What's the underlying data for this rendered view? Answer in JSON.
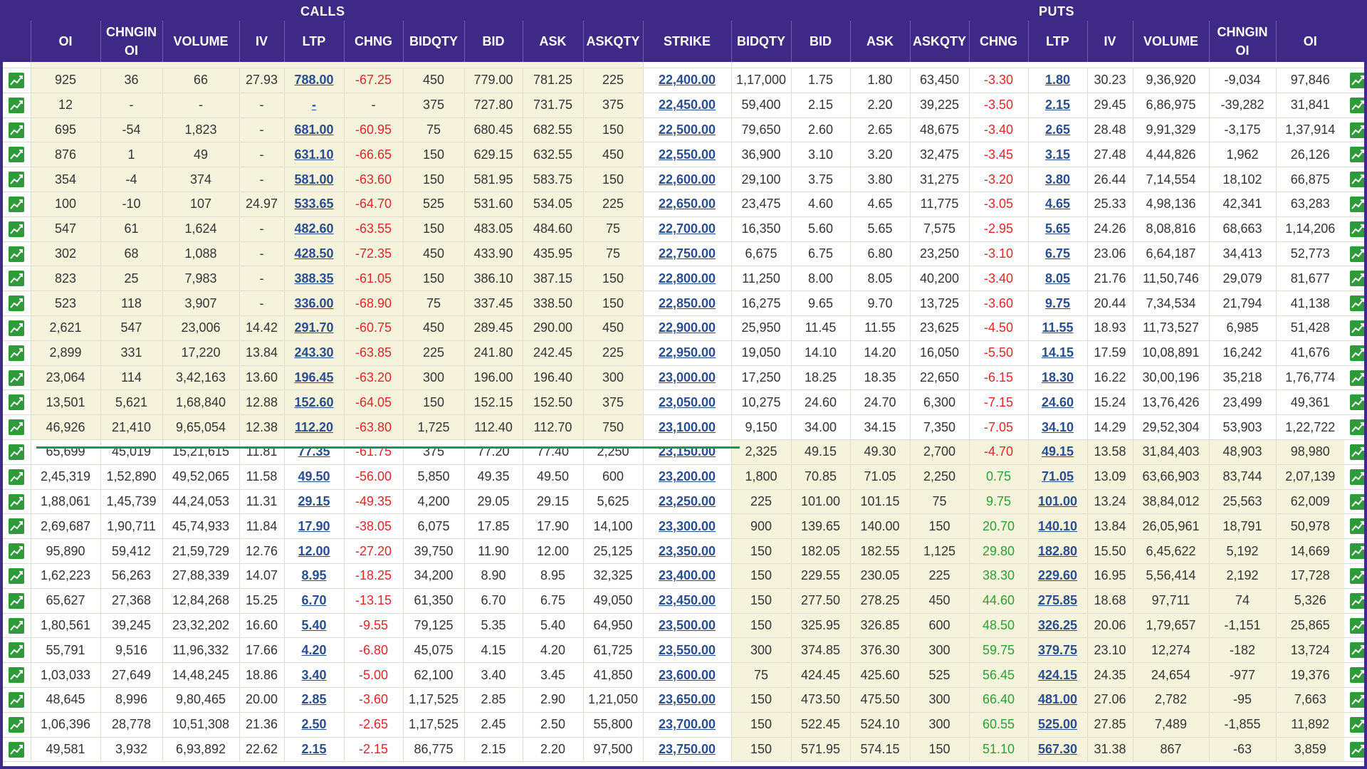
{
  "banner": {
    "calls_label": "CALLS",
    "puts_label": "PUTS"
  },
  "headers": {
    "calls": [
      "OI",
      "CHNG\nIN OI",
      "VOLUME",
      "IV",
      "LTP",
      "CHNG",
      "BID\nQTY",
      "BID",
      "ASK",
      "ASK\nQTY"
    ],
    "strike": "STRIKE",
    "puts": [
      "BID\nQTY",
      "BID",
      "ASK",
      "ASK\nQTY",
      "CHNG",
      "LTP",
      "IV",
      "VOLUME",
      "CHNG\nIN OI",
      "OI"
    ]
  },
  "colors": {
    "header_bg": "#3e2a86",
    "itm_bg": "#f6f3dc",
    "negative": "#e0262b",
    "positive": "#2e9e34",
    "link": "#2a4d8f",
    "atm_line": "#1a9a4a"
  },
  "icons": {
    "row_chart": "chart-icon"
  },
  "rows": [
    {
      "c": [
        "925",
        "36",
        "66",
        "27.93",
        "788.00",
        "-67.25",
        "450",
        "779.00",
        "781.25",
        "225"
      ],
      "s": "22,400.00",
      "p": [
        "1,17,000",
        "1.75",
        "1.80",
        "63,450",
        "-3.30",
        "1.80",
        "30.23",
        "9,36,920",
        "-9,034",
        "97,846"
      ],
      "z": "itm"
    },
    {
      "c": [
        "12",
        "-",
        "-",
        "-",
        "-",
        "-",
        "375",
        "727.80",
        "731.75",
        "375"
      ],
      "s": "22,450.00",
      "p": [
        "59,400",
        "2.15",
        "2.20",
        "39,225",
        "-3.50",
        "2.15",
        "29.45",
        "6,86,975",
        "-39,282",
        "31,841"
      ],
      "z": "itm"
    },
    {
      "c": [
        "695",
        "-54",
        "1,823",
        "-",
        "681.00",
        "-60.95",
        "75",
        "680.45",
        "682.55",
        "150"
      ],
      "s": "22,500.00",
      "p": [
        "79,650",
        "2.60",
        "2.65",
        "48,675",
        "-3.40",
        "2.65",
        "28.48",
        "9,91,329",
        "-3,175",
        "1,37,914"
      ],
      "z": "itm"
    },
    {
      "c": [
        "876",
        "1",
        "49",
        "-",
        "631.10",
        "-66.65",
        "150",
        "629.15",
        "632.55",
        "450"
      ],
      "s": "22,550.00",
      "p": [
        "36,900",
        "3.10",
        "3.20",
        "32,475",
        "-3.45",
        "3.15",
        "27.48",
        "4,44,826",
        "1,962",
        "26,126"
      ],
      "z": "itm"
    },
    {
      "c": [
        "354",
        "-4",
        "374",
        "-",
        "581.00",
        "-63.60",
        "150",
        "581.95",
        "583.75",
        "150"
      ],
      "s": "22,600.00",
      "p": [
        "29,100",
        "3.75",
        "3.80",
        "31,275",
        "-3.20",
        "3.80",
        "26.44",
        "7,14,554",
        "18,102",
        "66,875"
      ],
      "z": "itm"
    },
    {
      "c": [
        "100",
        "-10",
        "107",
        "24.97",
        "533.65",
        "-64.70",
        "525",
        "531.60",
        "534.05",
        "225"
      ],
      "s": "22,650.00",
      "p": [
        "23,475",
        "4.60",
        "4.65",
        "11,775",
        "-3.05",
        "4.65",
        "25.33",
        "4,98,136",
        "42,341",
        "63,283"
      ],
      "z": "itm"
    },
    {
      "c": [
        "547",
        "61",
        "1,624",
        "-",
        "482.60",
        "-63.55",
        "150",
        "483.05",
        "484.60",
        "75"
      ],
      "s": "22,700.00",
      "p": [
        "16,350",
        "5.60",
        "5.65",
        "7,575",
        "-2.95",
        "5.65",
        "24.26",
        "8,08,816",
        "68,663",
        "1,14,206"
      ],
      "z": "itm"
    },
    {
      "c": [
        "302",
        "68",
        "1,088",
        "-",
        "428.50",
        "-72.35",
        "450",
        "433.90",
        "435.95",
        "75"
      ],
      "s": "22,750.00",
      "p": [
        "6,675",
        "6.75",
        "6.80",
        "23,250",
        "-3.10",
        "6.75",
        "23.06",
        "6,64,187",
        "34,413",
        "52,773"
      ],
      "z": "itm"
    },
    {
      "c": [
        "823",
        "25",
        "7,983",
        "-",
        "388.35",
        "-61.05",
        "150",
        "386.10",
        "387.15",
        "150"
      ],
      "s": "22,800.00",
      "p": [
        "11,250",
        "8.00",
        "8.05",
        "40,200",
        "-3.40",
        "8.05",
        "21.76",
        "11,50,746",
        "29,079",
        "81,677"
      ],
      "z": "itm"
    },
    {
      "c": [
        "523",
        "118",
        "3,907",
        "-",
        "336.00",
        "-68.90",
        "75",
        "337.45",
        "338.50",
        "150"
      ],
      "s": "22,850.00",
      "p": [
        "16,275",
        "9.65",
        "9.70",
        "13,725",
        "-3.60",
        "9.75",
        "20.44",
        "7,34,534",
        "21,794",
        "41,138"
      ],
      "z": "itm"
    },
    {
      "c": [
        "2,621",
        "547",
        "23,006",
        "14.42",
        "291.70",
        "-60.75",
        "450",
        "289.45",
        "290.00",
        "450"
      ],
      "s": "22,900.00",
      "p": [
        "25,950",
        "11.45",
        "11.55",
        "23,625",
        "-4.50",
        "11.55",
        "18.93",
        "11,73,527",
        "6,985",
        "51,428"
      ],
      "z": "itm"
    },
    {
      "c": [
        "2,899",
        "331",
        "17,220",
        "13.84",
        "243.30",
        "-63.85",
        "225",
        "241.80",
        "242.45",
        "225"
      ],
      "s": "22,950.00",
      "p": [
        "19,050",
        "14.10",
        "14.20",
        "16,050",
        "-5.50",
        "14.15",
        "17.59",
        "10,08,891",
        "16,242",
        "41,676"
      ],
      "z": "itm"
    },
    {
      "c": [
        "23,064",
        "114",
        "3,42,163",
        "13.60",
        "196.45",
        "-63.20",
        "300",
        "196.00",
        "196.40",
        "300"
      ],
      "s": "23,000.00",
      "p": [
        "17,250",
        "18.25",
        "18.35",
        "22,650",
        "-6.15",
        "18.30",
        "16.22",
        "30,00,196",
        "35,218",
        "1,76,774"
      ],
      "z": "itm"
    },
    {
      "c": [
        "13,501",
        "5,621",
        "1,68,840",
        "12.88",
        "152.60",
        "-64.05",
        "150",
        "152.15",
        "152.50",
        "375"
      ],
      "s": "23,050.00",
      "p": [
        "10,275",
        "24.60",
        "24.70",
        "6,300",
        "-7.15",
        "24.60",
        "15.24",
        "13,76,426",
        "23,499",
        "49,361"
      ],
      "z": "itm"
    },
    {
      "c": [
        "46,926",
        "21,410",
        "9,65,054",
        "12.38",
        "112.20",
        "-63.80",
        "1,725",
        "112.40",
        "112.70",
        "750"
      ],
      "s": "23,100.00",
      "p": [
        "9,150",
        "34.00",
        "34.15",
        "7,350",
        "-7.05",
        "34.10",
        "14.29",
        "29,52,304",
        "53,903",
        "1,22,722"
      ],
      "z": "itm"
    },
    {
      "c": [
        "65,699",
        "45,019",
        "15,21,615",
        "11.81",
        "77.35",
        "-61.75",
        "375",
        "77.20",
        "77.40",
        "2,250"
      ],
      "s": "23,150.00",
      "p": [
        "2,325",
        "49.15",
        "49.30",
        "2,700",
        "-4.70",
        "49.15",
        "13.58",
        "31,84,403",
        "48,903",
        "98,980"
      ],
      "z": "otm"
    },
    {
      "c": [
        "2,45,319",
        "1,52,890",
        "49,52,065",
        "11.58",
        "49.50",
        "-56.00",
        "5,850",
        "49.35",
        "49.50",
        "600"
      ],
      "s": "23,200.00",
      "p": [
        "1,800",
        "70.85",
        "71.05",
        "2,250",
        "0.75",
        "71.05",
        "13.09",
        "63,66,903",
        "83,744",
        "2,07,139"
      ],
      "z": "otm"
    },
    {
      "c": [
        "1,88,061",
        "1,45,739",
        "44,24,053",
        "11.31",
        "29.15",
        "-49.35",
        "4,200",
        "29.05",
        "29.15",
        "5,625"
      ],
      "s": "23,250.00",
      "p": [
        "225",
        "101.00",
        "101.15",
        "75",
        "9.75",
        "101.00",
        "13.24",
        "38,84,012",
        "25,563",
        "62,009"
      ],
      "z": "otm"
    },
    {
      "c": [
        "2,69,687",
        "1,90,711",
        "45,74,933",
        "11.84",
        "17.90",
        "-38.05",
        "6,075",
        "17.85",
        "17.90",
        "14,100"
      ],
      "s": "23,300.00",
      "p": [
        "900",
        "139.65",
        "140.00",
        "150",
        "20.70",
        "140.10",
        "13.84",
        "26,05,961",
        "18,791",
        "50,978"
      ],
      "z": "otm"
    },
    {
      "c": [
        "95,890",
        "59,412",
        "21,59,729",
        "12.76",
        "12.00",
        "-27.20",
        "39,750",
        "11.90",
        "12.00",
        "25,125"
      ],
      "s": "23,350.00",
      "p": [
        "150",
        "182.05",
        "182.55",
        "1,125",
        "29.80",
        "182.80",
        "15.50",
        "6,45,622",
        "5,192",
        "14,669"
      ],
      "z": "otm"
    },
    {
      "c": [
        "1,62,223",
        "56,263",
        "27,88,339",
        "14.07",
        "8.95",
        "-18.25",
        "34,200",
        "8.90",
        "8.95",
        "32,325"
      ],
      "s": "23,400.00",
      "p": [
        "150",
        "229.55",
        "230.05",
        "225",
        "38.30",
        "229.60",
        "16.95",
        "5,56,414",
        "2,192",
        "17,728"
      ],
      "z": "otm"
    },
    {
      "c": [
        "65,627",
        "27,368",
        "12,84,268",
        "15.25",
        "6.70",
        "-13.15",
        "61,350",
        "6.70",
        "6.75",
        "49,050"
      ],
      "s": "23,450.00",
      "p": [
        "150",
        "277.50",
        "278.25",
        "450",
        "44.60",
        "275.85",
        "18.68",
        "97,711",
        "74",
        "5,326"
      ],
      "z": "otm"
    },
    {
      "c": [
        "1,80,561",
        "39,245",
        "23,32,202",
        "16.60",
        "5.40",
        "-9.55",
        "79,125",
        "5.35",
        "5.40",
        "64,950"
      ],
      "s": "23,500.00",
      "p": [
        "150",
        "325.95",
        "326.85",
        "600",
        "48.50",
        "326.25",
        "20.06",
        "1,79,657",
        "-1,151",
        "25,865"
      ],
      "z": "otm"
    },
    {
      "c": [
        "55,791",
        "9,516",
        "11,96,332",
        "17.66",
        "4.20",
        "-6.80",
        "45,075",
        "4.15",
        "4.20",
        "61,725"
      ],
      "s": "23,550.00",
      "p": [
        "300",
        "374.85",
        "376.30",
        "300",
        "59.75",
        "379.75",
        "23.10",
        "12,274",
        "-182",
        "13,724"
      ],
      "z": "otm"
    },
    {
      "c": [
        "1,03,033",
        "27,649",
        "14,48,245",
        "18.86",
        "3.40",
        "-5.00",
        "62,100",
        "3.40",
        "3.45",
        "41,850"
      ],
      "s": "23,600.00",
      "p": [
        "75",
        "424.45",
        "425.60",
        "525",
        "56.45",
        "424.15",
        "24.35",
        "24,654",
        "-977",
        "19,376"
      ],
      "z": "otm"
    },
    {
      "c": [
        "48,645",
        "8,996",
        "9,80,465",
        "20.00",
        "2.85",
        "-3.60",
        "1,17,525",
        "2.85",
        "2.90",
        "1,21,050"
      ],
      "s": "23,650.00",
      "p": [
        "150",
        "473.50",
        "475.50",
        "300",
        "66.40",
        "481.00",
        "27.06",
        "2,782",
        "-95",
        "7,663"
      ],
      "z": "otm"
    },
    {
      "c": [
        "1,06,396",
        "28,778",
        "10,51,308",
        "21.36",
        "2.50",
        "-2.65",
        "1,17,525",
        "2.45",
        "2.50",
        "55,800"
      ],
      "s": "23,700.00",
      "p": [
        "150",
        "522.45",
        "524.10",
        "300",
        "60.55",
        "525.00",
        "27.85",
        "7,489",
        "-1,855",
        "11,892"
      ],
      "z": "otm"
    },
    {
      "c": [
        "49,581",
        "3,932",
        "6,93,892",
        "22.62",
        "2.15",
        "-2.15",
        "86,775",
        "2.15",
        "2.20",
        "97,500"
      ],
      "s": "23,750.00",
      "p": [
        "150",
        "571.95",
        "574.15",
        "150",
        "51.10",
        "567.30",
        "31.38",
        "867",
        "-63",
        "3,859"
      ],
      "z": "otm"
    }
  ]
}
